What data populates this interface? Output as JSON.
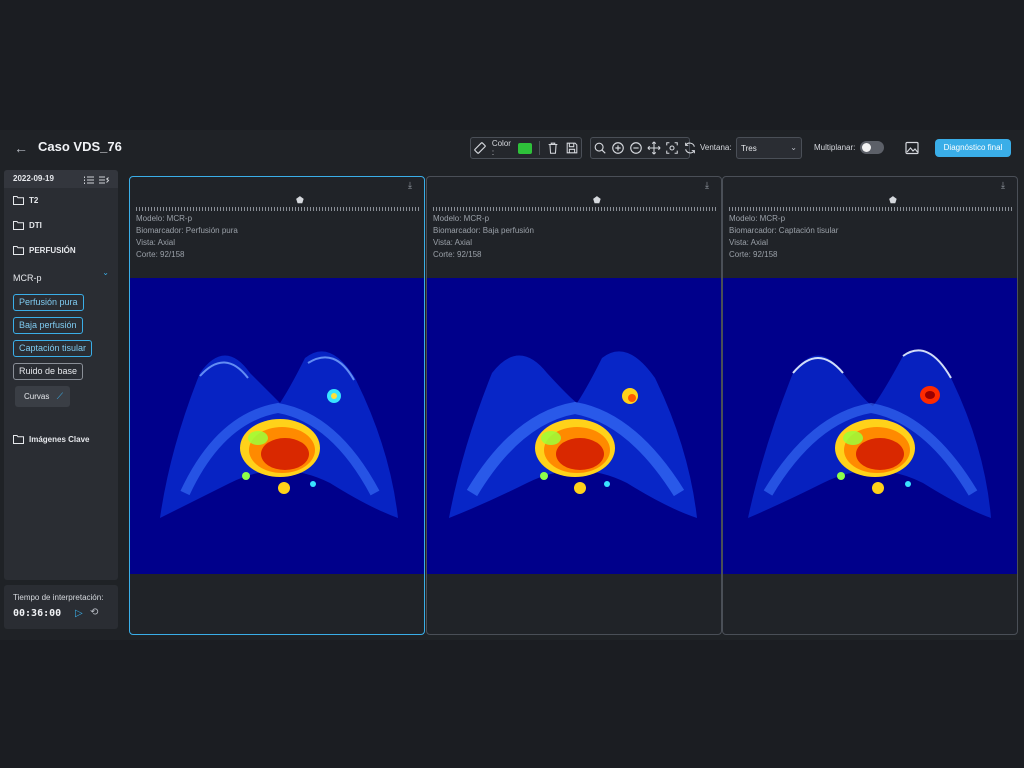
{
  "header": {
    "back_icon": "arrow-left-icon",
    "case_title": "Caso VDS_76",
    "color_label": "Color :",
    "color_value": "#2ec13a",
    "ventana_label": "Ventana:",
    "ventana_value": "Tres",
    "multiplanar_label": "Multiplanar:",
    "multiplanar_on": false,
    "diagnosis_button": "Diagnóstico final"
  },
  "sidebar": {
    "date": "2022-09-19",
    "folders": [
      "T2",
      "DTI",
      "PERFUSIÓN"
    ],
    "model": "MCR-p",
    "chips": [
      "Perfusión pura",
      "Baja perfusión",
      "Captación tisular",
      "Ruido de base"
    ],
    "curvas": "Curvas",
    "key_images": "Imágenes Clave"
  },
  "timer": {
    "label": "Tiempo de interpretación:",
    "value": "00:36:00"
  },
  "viewports": [
    {
      "modelo": "Modelo: MCR-p",
      "biomarcador": "Biomarcador: Perfusión pura",
      "vista": "Vista: Axial",
      "corte": "Corte: 92/158"
    },
    {
      "modelo": "Modelo: MCR-p",
      "biomarcador": "Biomarcador: Baja perfusión",
      "vista": "Vista: Axial",
      "corte": "Corte: 92/158"
    },
    {
      "modelo": "Modelo: MCR-p",
      "biomarcador": "Biomarcador: Captación tisular",
      "vista": "Vista: Axial",
      "corte": "Corte: 92/158"
    }
  ],
  "colors": {
    "accent": "#3aaee8",
    "background": "#1f2226",
    "image_background": "#00008b"
  }
}
